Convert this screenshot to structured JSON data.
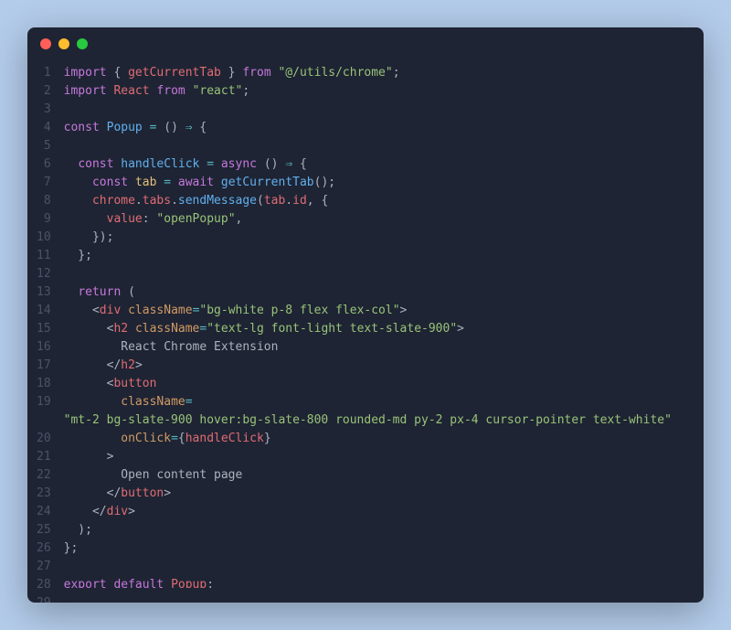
{
  "window": {
    "traffic_lights": [
      "close",
      "minimize",
      "maximize"
    ]
  },
  "code": {
    "lines": [
      [
        {
          "c": "kw",
          "t": "import"
        },
        {
          "c": "pun",
          "t": " { "
        },
        {
          "c": "id",
          "t": "getCurrentTab"
        },
        {
          "c": "pun",
          "t": " } "
        },
        {
          "c": "kw",
          "t": "from"
        },
        {
          "c": "pun",
          "t": " "
        },
        {
          "c": "str",
          "t": "\"@/utils/chrome\""
        },
        {
          "c": "pun",
          "t": ";"
        }
      ],
      [
        {
          "c": "kw",
          "t": "import"
        },
        {
          "c": "pun",
          "t": " "
        },
        {
          "c": "id",
          "t": "React"
        },
        {
          "c": "pun",
          "t": " "
        },
        {
          "c": "kw",
          "t": "from"
        },
        {
          "c": "pun",
          "t": " "
        },
        {
          "c": "str",
          "t": "\"react\""
        },
        {
          "c": "pun",
          "t": ";"
        }
      ],
      [],
      [
        {
          "c": "kw",
          "t": "const"
        },
        {
          "c": "pun",
          "t": " "
        },
        {
          "c": "fn",
          "t": "Popup"
        },
        {
          "c": "pun",
          "t": " "
        },
        {
          "c": "op",
          "t": "="
        },
        {
          "c": "pun",
          "t": " () "
        },
        {
          "c": "op",
          "t": "⇒"
        },
        {
          "c": "pun",
          "t": " {"
        }
      ],
      [],
      [
        {
          "c": "pun",
          "t": "  "
        },
        {
          "c": "kw",
          "t": "const"
        },
        {
          "c": "pun",
          "t": " "
        },
        {
          "c": "fn",
          "t": "handleClick"
        },
        {
          "c": "pun",
          "t": " "
        },
        {
          "c": "op",
          "t": "="
        },
        {
          "c": "pun",
          "t": " "
        },
        {
          "c": "kw",
          "t": "async"
        },
        {
          "c": "pun",
          "t": " () "
        },
        {
          "c": "op",
          "t": "⇒"
        },
        {
          "c": "pun",
          "t": " {"
        }
      ],
      [
        {
          "c": "pun",
          "t": "    "
        },
        {
          "c": "kw",
          "t": "const"
        },
        {
          "c": "pun",
          "t": " "
        },
        {
          "c": "def",
          "t": "tab"
        },
        {
          "c": "pun",
          "t": " "
        },
        {
          "c": "op",
          "t": "="
        },
        {
          "c": "pun",
          "t": " "
        },
        {
          "c": "kw",
          "t": "await"
        },
        {
          "c": "pun",
          "t": " "
        },
        {
          "c": "fn",
          "t": "getCurrentTab"
        },
        {
          "c": "pun",
          "t": "();"
        }
      ],
      [
        {
          "c": "pun",
          "t": "    "
        },
        {
          "c": "id",
          "t": "chrome"
        },
        {
          "c": "pun",
          "t": "."
        },
        {
          "c": "prop",
          "t": "tabs"
        },
        {
          "c": "pun",
          "t": "."
        },
        {
          "c": "fn",
          "t": "sendMessage"
        },
        {
          "c": "pun",
          "t": "("
        },
        {
          "c": "id",
          "t": "tab"
        },
        {
          "c": "pun",
          "t": "."
        },
        {
          "c": "prop",
          "t": "id"
        },
        {
          "c": "pun",
          "t": ", {"
        }
      ],
      [
        {
          "c": "pun",
          "t": "      "
        },
        {
          "c": "prop",
          "t": "value"
        },
        {
          "c": "pun",
          "t": ": "
        },
        {
          "c": "str",
          "t": "\"openPopup\""
        },
        {
          "c": "pun",
          "t": ","
        }
      ],
      [
        {
          "c": "pun",
          "t": "    });"
        }
      ],
      [
        {
          "c": "pun",
          "t": "  };"
        }
      ],
      [],
      [
        {
          "c": "pun",
          "t": "  "
        },
        {
          "c": "kw",
          "t": "return"
        },
        {
          "c": "pun",
          "t": " ("
        }
      ],
      [
        {
          "c": "pun",
          "t": "    <"
        },
        {
          "c": "id",
          "t": "div"
        },
        {
          "c": "pun",
          "t": " "
        },
        {
          "c": "attr",
          "t": "className"
        },
        {
          "c": "op",
          "t": "="
        },
        {
          "c": "str",
          "t": "\"bg-white p-8 flex flex-col\""
        },
        {
          "c": "pun",
          "t": ">"
        }
      ],
      [
        {
          "c": "pun",
          "t": "      <"
        },
        {
          "c": "id",
          "t": "h2"
        },
        {
          "c": "pun",
          "t": " "
        },
        {
          "c": "attr",
          "t": "className"
        },
        {
          "c": "op",
          "t": "="
        },
        {
          "c": "str",
          "t": "\"text-lg font-light text-slate-900\""
        },
        {
          "c": "pun",
          "t": ">"
        }
      ],
      [
        {
          "c": "txt",
          "t": "        React Chrome Extension"
        }
      ],
      [
        {
          "c": "pun",
          "t": "      </"
        },
        {
          "c": "id",
          "t": "h2"
        },
        {
          "c": "pun",
          "t": ">"
        }
      ],
      [
        {
          "c": "pun",
          "t": "      <"
        },
        {
          "c": "id",
          "t": "button"
        }
      ],
      [
        {
          "c": "pun",
          "t": "        "
        },
        {
          "c": "attr",
          "t": "className"
        },
        {
          "c": "op",
          "t": "="
        }
      ],
      [
        {
          "c": "str",
          "t": "\"mt-2 bg-slate-900 hover:bg-slate-800 rounded-md py-2 px-4 cursor-pointer text-white\""
        }
      ],
      [
        {
          "c": "pun",
          "t": "        "
        },
        {
          "c": "attr",
          "t": "onClick"
        },
        {
          "c": "op",
          "t": "="
        },
        {
          "c": "pun",
          "t": "{"
        },
        {
          "c": "id",
          "t": "handleClick"
        },
        {
          "c": "pun",
          "t": "}"
        }
      ],
      [
        {
          "c": "pun",
          "t": "      >"
        }
      ],
      [
        {
          "c": "txt",
          "t": "        Open content page"
        }
      ],
      [
        {
          "c": "pun",
          "t": "      </"
        },
        {
          "c": "id",
          "t": "button"
        },
        {
          "c": "pun",
          "t": ">"
        }
      ],
      [
        {
          "c": "pun",
          "t": "    </"
        },
        {
          "c": "id",
          "t": "div"
        },
        {
          "c": "pun",
          "t": ">"
        }
      ],
      [
        {
          "c": "pun",
          "t": "  );"
        }
      ],
      [
        {
          "c": "pun",
          "t": "};"
        }
      ],
      [],
      [
        {
          "c": "kw",
          "t": "export"
        },
        {
          "c": "pun",
          "t": " "
        },
        {
          "c": "kw",
          "t": "default"
        },
        {
          "c": "pun",
          "t": " "
        },
        {
          "c": "id",
          "t": "Popup"
        },
        {
          "c": "pun",
          "t": ";"
        }
      ],
      []
    ]
  }
}
